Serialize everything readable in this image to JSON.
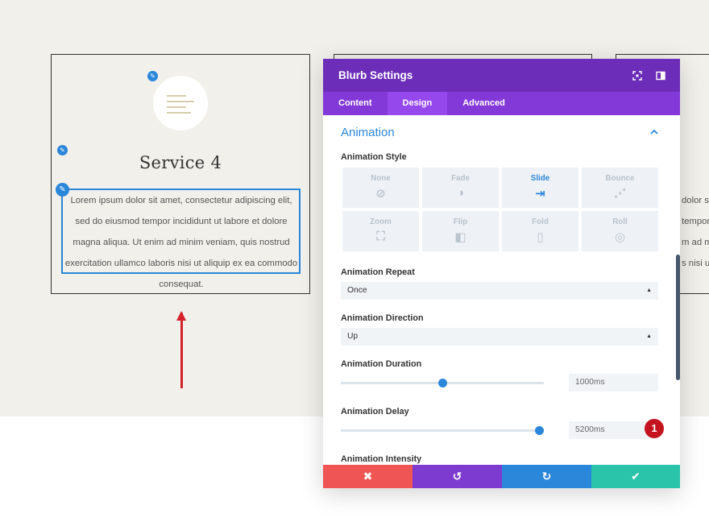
{
  "blurb": {
    "title": "Service 4",
    "body": "Lorem ipsum dolor sit amet, consectetur adipiscing elit, sed do eiusmod tempor incididunt ut labore et dolore magna aliqua. Ut enim ad minim veniam, quis nostrud exercitation ullamco laboris nisi ut aliquip ex ea commodo consequat.",
    "partial_lines": [
      "dolor s",
      "tempor",
      "m ad m",
      "s nisi ut"
    ]
  },
  "modal": {
    "title": "Blurb Settings",
    "tabs": [
      {
        "label": "Content",
        "active": false
      },
      {
        "label": "Design",
        "active": true
      },
      {
        "label": "Advanced",
        "active": false
      }
    ],
    "section_title": "Animation",
    "animation_style": {
      "label": "Animation Style",
      "options": [
        {
          "label": "None",
          "icon": "none-icon",
          "glyph": "⊘",
          "active": false
        },
        {
          "label": "Fade",
          "icon": "fade-icon",
          "glyph": "◑",
          "active": false
        },
        {
          "label": "Slide",
          "icon": "slide-icon",
          "glyph": "⇥",
          "active": true
        },
        {
          "label": "Bounce",
          "icon": "bounce-icon",
          "glyph": "⋰",
          "active": false
        },
        {
          "label": "Zoom",
          "icon": "zoom-icon",
          "glyph": "⛶",
          "active": false
        },
        {
          "label": "Flip",
          "icon": "flip-icon",
          "glyph": "◧",
          "active": false
        },
        {
          "label": "Fold",
          "icon": "fold-icon",
          "glyph": "▯",
          "active": false
        },
        {
          "label": "Roll",
          "icon": "roll-icon",
          "glyph": "◎",
          "active": false
        }
      ]
    },
    "animation_repeat": {
      "label": "Animation Repeat",
      "value": "Once"
    },
    "animation_direction": {
      "label": "Animation Direction",
      "value": "Up"
    },
    "animation_duration": {
      "label": "Animation Duration",
      "value": "1000ms",
      "slider_fraction": 0.5
    },
    "animation_delay": {
      "label": "Animation Delay",
      "value": "5200ms",
      "slider_fraction": 0.98
    },
    "animation_intensity": {
      "label": "Animation Intensity"
    },
    "badge": "1"
  },
  "footer": {
    "cancel_icon": "✖",
    "undo_icon": "↺",
    "redo_icon": "↻",
    "save_icon": "✔"
  },
  "colors": {
    "header_purple": "#6c2eb9",
    "tab_purple": "#8338d8",
    "accent_blue": "#2b87da",
    "cancel_red": "#ef5555",
    "save_green": "#29c4a9",
    "arrow_red": "#d4212b"
  }
}
